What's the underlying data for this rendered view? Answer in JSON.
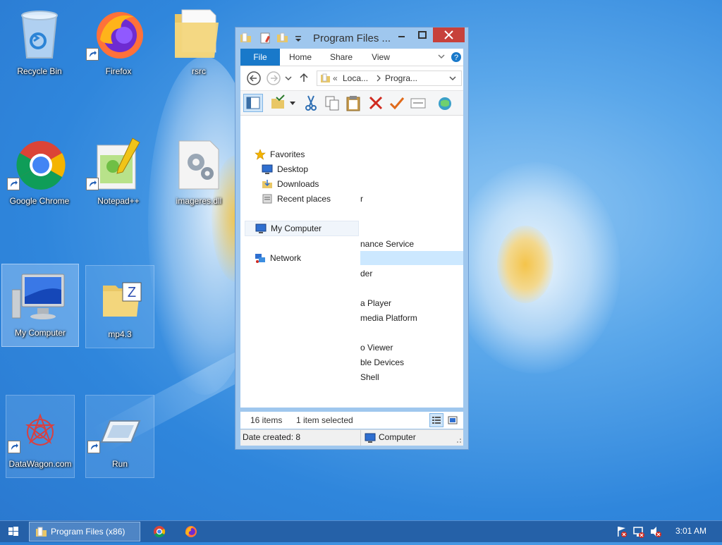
{
  "desktop": {
    "icons": [
      {
        "label": "Recycle Bin"
      },
      {
        "label": "Firefox"
      },
      {
        "label": "rsrc"
      },
      {
        "label": "Google Chrome"
      },
      {
        "label": "Notepad++"
      },
      {
        "label": "imageres.dll"
      },
      {
        "label": "My Computer"
      },
      {
        "label": "mp4.3"
      },
      {
        "label": "DataWagon.com"
      },
      {
        "label": "Run"
      }
    ]
  },
  "explorer": {
    "title": "Program Files ...",
    "tabs": {
      "file": "File",
      "home": "Home",
      "share": "Share",
      "view": "View"
    },
    "address": {
      "sep": "«",
      "part1": "Loca...",
      "part2": "Progra..."
    },
    "nav": {
      "favorites": "Favorites",
      "desktop": "Desktop",
      "downloads": "Downloads",
      "recent": "Recent places",
      "my_computer": "My Computer",
      "network": "Network"
    },
    "list_fragments": [
      "r",
      "nance Service",
      "der",
      "a Player",
      "media Platform",
      "o Viewer",
      "ble Devices",
      "Shell"
    ],
    "status": {
      "items": "16 items",
      "selected": "1 item selected"
    },
    "details": {
      "date_created": "Date created: 8",
      "location": "Computer"
    }
  },
  "taskbar": {
    "explorer_label": "Program Files (x86)",
    "clock": "3:01 AM"
  },
  "colors": {
    "accent": "#1979ca",
    "close": "#c7413b",
    "taskbar": "#255ea4"
  }
}
